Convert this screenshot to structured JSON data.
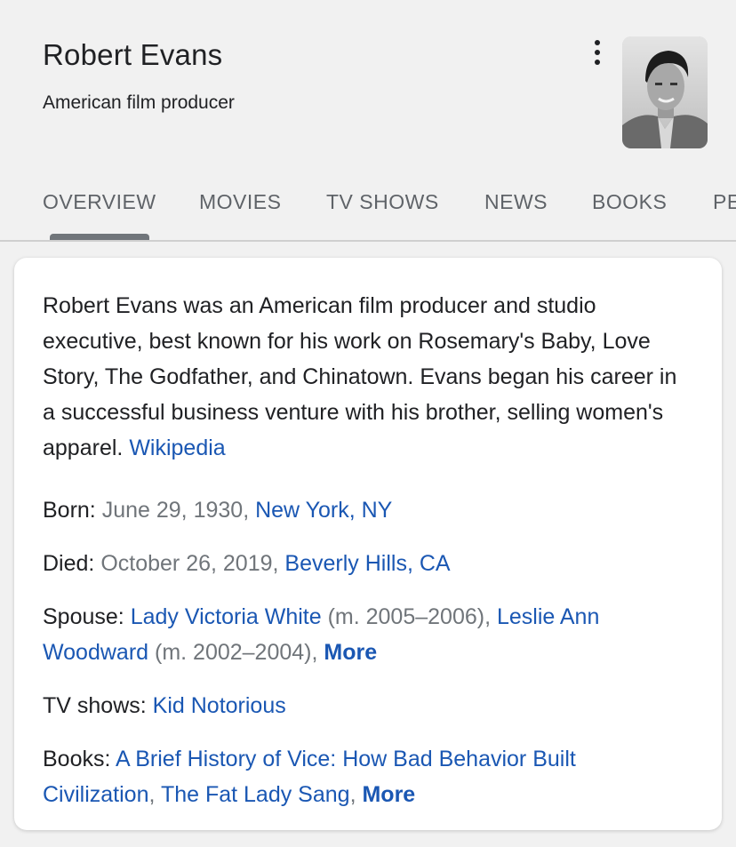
{
  "header": {
    "title": "Robert Evans",
    "subtitle": "American film producer",
    "menu_icon": "more-vert-icon"
  },
  "tabs": [
    {
      "label": "OVERVIEW",
      "active": true
    },
    {
      "label": "MOVIES",
      "active": false
    },
    {
      "label": "TV SHOWS",
      "active": false
    },
    {
      "label": "NEWS",
      "active": false
    },
    {
      "label": "BOOKS",
      "active": false
    },
    {
      "label": "PE",
      "active": false
    }
  ],
  "description": {
    "text": "Robert Evans was an American film producer and studio executive, best known for his work on Rosemary's Baby, Love Story, The Godfather, and Chinatown. Evans began his career in a successful business venture with his brother, selling women's apparel.",
    "source_link": "Wikipedia"
  },
  "facts": {
    "born": {
      "label": "Born:",
      "date": "June 29, 1930,",
      "place": "New York, NY"
    },
    "died": {
      "label": "Died:",
      "date": "October 26, 2019,",
      "place": "Beverly Hills, CA"
    },
    "spouse": {
      "label": "Spouse:",
      "spouse1": "Lady Victoria White",
      "spouse1_years": "(m. 2005–2006),",
      "spouse2_line1": "Leslie Ann",
      "spouse2_line2": "Woodward",
      "spouse2_years": "(m. 2002–2004),",
      "more": "More"
    },
    "tv_shows": {
      "label": "TV shows:",
      "show1": "Kid Notorious"
    },
    "books": {
      "label": "Books:",
      "book1_line1": "A Brief History of Vice: How Bad Behavior Built",
      "book1_line2": "Civilization",
      "separator": ",",
      "book2": "The Fat Lady Sang",
      "separator2": ",",
      "more": "More"
    }
  },
  "colors": {
    "link": "#1a57b3",
    "text": "#202124",
    "muted": "#70757a",
    "background": "#f1f1f1"
  }
}
